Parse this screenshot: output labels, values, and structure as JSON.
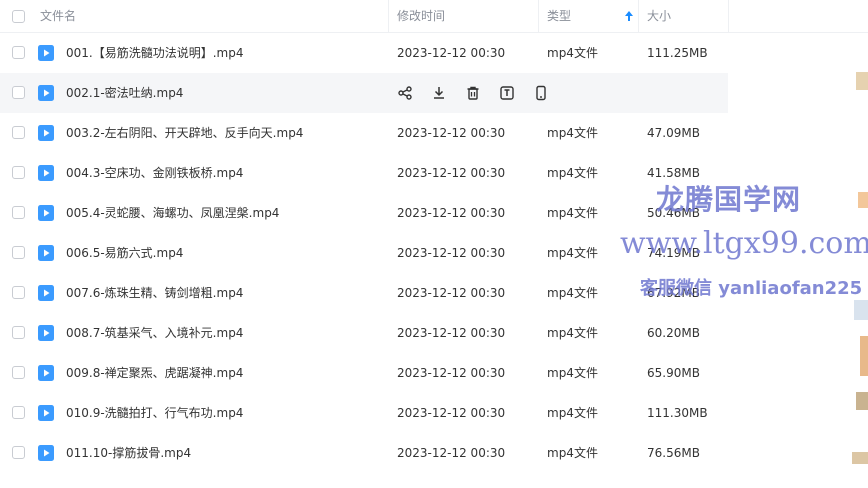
{
  "columns": {
    "name": "文件名",
    "modified": "修改时间",
    "type": "类型",
    "size": "大小"
  },
  "rows": [
    {
      "name": "001.【易筋洗髓功法说明】.mp4",
      "modified": "2023-12-12 00:30",
      "type": "mp4文件",
      "size": "111.25MB"
    },
    {
      "name": "002.1-密法吐纳.mp4",
      "modified": "",
      "type": "",
      "size": ""
    },
    {
      "name": "003.2-左右阴阳、开天辟地、反手向天.mp4",
      "modified": "2023-12-12 00:30",
      "type": "mp4文件",
      "size": "47.09MB"
    },
    {
      "name": "004.3-空床功、金刚铁板桥.mp4",
      "modified": "2023-12-12 00:30",
      "type": "mp4文件",
      "size": "41.58MB"
    },
    {
      "name": "005.4-灵蛇腰、海螺功、凤凰涅槃.mp4",
      "modified": "2023-12-12 00:30",
      "type": "mp4文件",
      "size": "50.46MB"
    },
    {
      "name": "006.5-易筋六式.mp4",
      "modified": "2023-12-12 00:30",
      "type": "mp4文件",
      "size": "74.19MB"
    },
    {
      "name": "007.6-炼珠生精、铸剑增粗.mp4",
      "modified": "2023-12-12 00:30",
      "type": "mp4文件",
      "size": "67.92MB"
    },
    {
      "name": "008.7-筑基采气、入境补元.mp4",
      "modified": "2023-12-12 00:30",
      "type": "mp4文件",
      "size": "60.20MB"
    },
    {
      "name": "009.8-禅定聚炁、虎踞凝神.mp4",
      "modified": "2023-12-12 00:30",
      "type": "mp4文件",
      "size": "65.90MB"
    },
    {
      "name": "010.9-洗髓拍打、行气布功.mp4",
      "modified": "2023-12-12 00:30",
      "type": "mp4文件",
      "size": "111.30MB"
    },
    {
      "name": "011.10-撑筋拔骨.mp4",
      "modified": "2023-12-12 00:30",
      "type": "mp4文件",
      "size": "76.56MB"
    }
  ],
  "hover_actions": [
    "share-icon",
    "download-icon",
    "delete-icon",
    "rename-icon",
    "mobile-icon"
  ],
  "sort": {
    "column": "type",
    "direction": "ascending"
  },
  "watermark": {
    "line1": "龙腾国学网",
    "line2": "www.ltgx99.com",
    "line3": "客服微信 yanliaofan225"
  },
  "colors": {
    "accent": "#1a8cff",
    "fileicon": "#3b9bff",
    "watermark": "#6f77d0"
  }
}
